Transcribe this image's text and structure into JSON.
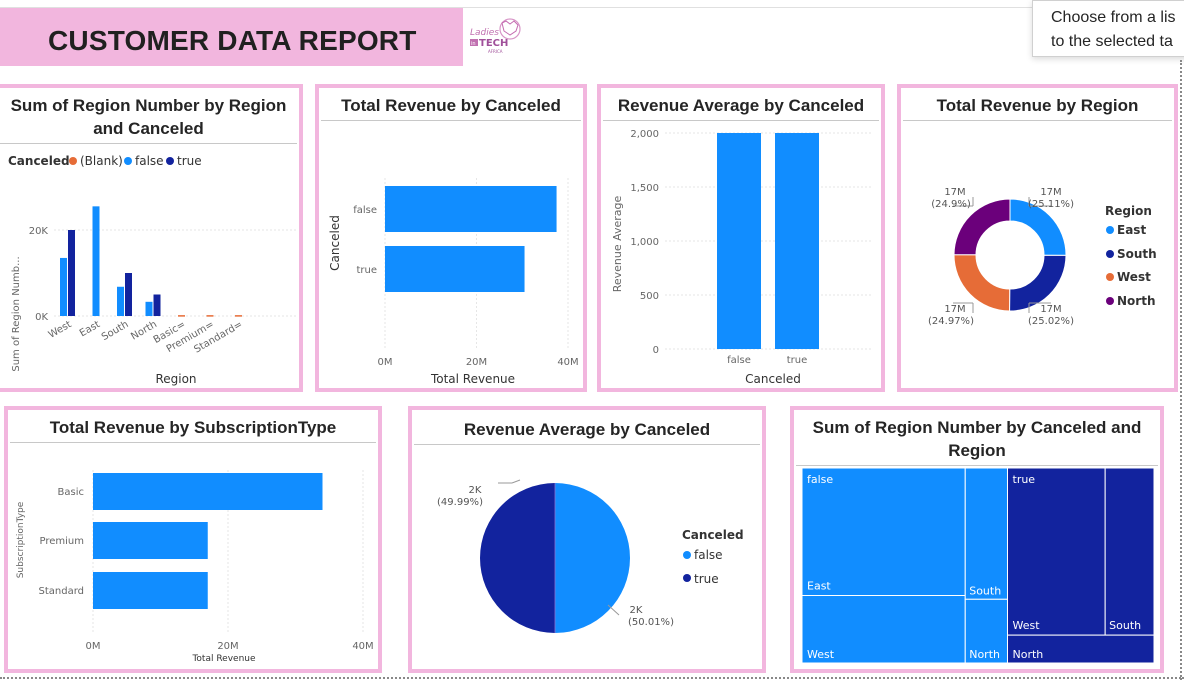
{
  "header": {
    "title": "CUSTOMER DATA REPORT",
    "logo_line1": "Ladies",
    "logo_line2": "TECH",
    "logo_badge": "in",
    "logo_line3": "AFRICA"
  },
  "tooltip": {
    "line1": "Choose from a lis",
    "line2": "to the selected ta"
  },
  "colors": {
    "accent_pink": "#f2b6de",
    "false_blue": "#118dff",
    "true_navy": "#12239e",
    "blank_orange": "#e66c37",
    "north_purple": "#6b007b"
  },
  "charts": {
    "region_canceled": {
      "title_l1": "Sum of Region Number by Region",
      "title_l2": "and Canceled",
      "legend_title": "Canceled",
      "legend": [
        "(Blank)",
        "false",
        "true"
      ],
      "ylabel": "Sum of Region Numb...",
      "xlabel": "Region",
      "yticks": [
        "20K",
        "0K"
      ],
      "categories": [
        "West",
        "East",
        "South",
        "North",
        "Basic=",
        "Premium=",
        "Standard="
      ]
    },
    "rev_canceled_bar": {
      "title": "Total Revenue by Canceled",
      "ylabel": "Canceled",
      "xlabel": "Total Revenue",
      "categories": [
        "false",
        "true"
      ],
      "xticks": [
        "0M",
        "20M",
        "40M"
      ]
    },
    "rev_avg_column": {
      "title": "Revenue Average by Canceled",
      "ylabel": "Revenue Average",
      "xlabel": "Canceled",
      "categories": [
        "false",
        "true"
      ],
      "yticks": [
        "2,000",
        "1,500",
        "1,000",
        "500",
        "0"
      ]
    },
    "rev_region_donut": {
      "title": "Total Revenue by Region",
      "legend_title": "Region",
      "legend": [
        "East",
        "South",
        "West",
        "North"
      ],
      "labels": [
        {
          "value": "17M",
          "pct": "(25.11%)"
        },
        {
          "value": "17M",
          "pct": "(25.02%)"
        },
        {
          "value": "17M",
          "pct": "(24.97%)"
        },
        {
          "value": "17M",
          "pct": "(24.9%)"
        }
      ]
    },
    "rev_subscription": {
      "title": "Total Revenue by SubscriptionType",
      "ylabel": "SubscriptionType",
      "xlabel": "Total Revenue",
      "categories": [
        "Basic",
        "Premium",
        "Standard"
      ],
      "xticks": [
        "0M",
        "20M",
        "40M"
      ]
    },
    "rev_avg_pie": {
      "title": "Revenue Average by Canceled",
      "legend_title": "Canceled",
      "legend": [
        "false",
        "true"
      ],
      "labels": [
        {
          "value": "2K",
          "pct": "(49.99%)"
        },
        {
          "value": "2K",
          "pct": "(50.01%)"
        }
      ]
    },
    "treemap": {
      "title_l1": "Sum of Region Number by Canceled and",
      "title_l2": "Region",
      "groups": [
        "false",
        "true"
      ],
      "cells": [
        "East",
        "South",
        "West",
        "North",
        "West",
        "South",
        "North"
      ]
    }
  },
  "chart_data": [
    {
      "type": "bar",
      "title": "Sum of Region Number by Region and Canceled",
      "xlabel": "Region",
      "ylabel": "Sum of Region Numb...",
      "categories": [
        "West",
        "East",
        "South",
        "North",
        "Basic=",
        "Premium=",
        "Standard="
      ],
      "series": [
        {
          "name": "(Blank)",
          "values": [
            0,
            0,
            0,
            0,
            200,
            200,
            200
          ]
        },
        {
          "name": "false",
          "values": [
            13500,
            25500,
            6800,
            3300,
            0,
            0,
            0
          ]
        },
        {
          "name": "true",
          "values": [
            20000,
            0,
            10000,
            5000,
            0,
            0,
            0
          ]
        }
      ],
      "ylim": [
        0,
        27000
      ],
      "legend": "top"
    },
    {
      "type": "bar",
      "title": "Total Revenue by Canceled",
      "xlabel": "Total Revenue",
      "ylabel": "Canceled",
      "categories": [
        "false",
        "true"
      ],
      "values": [
        37500000,
        30500000
      ],
      "xlim": [
        0,
        40000000
      ]
    },
    {
      "type": "bar",
      "title": "Revenue Average by Canceled",
      "xlabel": "Canceled",
      "ylabel": "Revenue Average",
      "categories": [
        "false",
        "true"
      ],
      "values": [
        2000,
        2000
      ],
      "ylim": [
        0,
        2000
      ]
    },
    {
      "type": "pie",
      "title": "Total Revenue by Region",
      "categories": [
        "East",
        "South",
        "West",
        "North"
      ],
      "values": [
        25.11,
        25.02,
        24.97,
        24.9
      ],
      "legend": "right"
    },
    {
      "type": "bar",
      "title": "Total Revenue by SubscriptionType",
      "xlabel": "Total Revenue",
      "ylabel": "SubscriptionType",
      "categories": [
        "Basic",
        "Premium",
        "Standard"
      ],
      "values": [
        34000000,
        17000000,
        17000000
      ],
      "xlim": [
        0,
        40000000
      ]
    },
    {
      "type": "pie",
      "title": "Revenue Average by Canceled",
      "categories": [
        "false",
        "true"
      ],
      "values": [
        50.01,
        49.99
      ],
      "legend": "right"
    },
    {
      "type": "heatmap",
      "title": "Sum of Region Number by Canceled and Region",
      "categories": [
        "false",
        "true"
      ],
      "series": [
        {
          "name": "false",
          "values": {
            "East": 25500,
            "West": 13500,
            "South": 6800,
            "North": 3300
          }
        },
        {
          "name": "true",
          "values": {
            "West": 20000,
            "South": 10000,
            "North": 5000
          }
        }
      ]
    }
  ]
}
